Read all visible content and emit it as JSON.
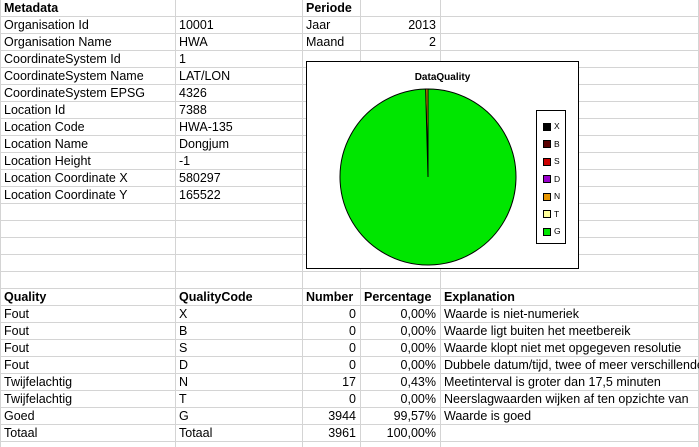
{
  "metadata": {
    "header": "Metadata",
    "rows": [
      {
        "label": "Organisation Id",
        "value": "10001"
      },
      {
        "label": "Organisation Name",
        "value": "HWA"
      },
      {
        "label": "CoordinateSystem Id",
        "value": "1"
      },
      {
        "label": "CoordinateSystem Name",
        "value": "LAT/LON"
      },
      {
        "label": "CoordinateSystem EPSG",
        "value": "4326"
      },
      {
        "label": "Location Id",
        "value": "7388"
      },
      {
        "label": "Location Code",
        "value": "HWA-135"
      },
      {
        "label": "Location Name",
        "value": "Dongjum"
      },
      {
        "label": "Location Height",
        "value": "-1"
      },
      {
        "label": "Location Coordinate X",
        "value": "580297"
      },
      {
        "label": "Location Coordinate Y",
        "value": "165522"
      }
    ]
  },
  "periode": {
    "header": "Periode",
    "rows": [
      {
        "label": "Jaar",
        "value": "2013"
      },
      {
        "label": "Maand",
        "value": "2"
      }
    ]
  },
  "quality_table": {
    "headers": [
      "Quality",
      "QualityCode",
      "Number",
      "Percentage",
      "Explanation"
    ],
    "rows": [
      [
        "Fout",
        "X",
        "0",
        "0,00%",
        "Waarde is niet-numeriek"
      ],
      [
        "Fout",
        "B",
        "0",
        "0,00%",
        "Waarde ligt buiten het meetbereik"
      ],
      [
        "Fout",
        "S",
        "0",
        "0,00%",
        "Waarde klopt niet met opgegeven resolutie"
      ],
      [
        "Fout",
        "D",
        "0",
        "0,00%",
        "Dubbele datum/tijd, twee of meer verschillende"
      ],
      [
        "Twijfelachtig",
        "N",
        "17",
        "0,43%",
        "Meetinterval is groter dan 17,5 minuten"
      ],
      [
        "Twijfelachtig",
        "T",
        "0",
        "0,00%",
        "Neerslagwaarden wijken af ten opzichte van"
      ],
      [
        "Goed",
        "G",
        "3944",
        "99,57%",
        "Waarde is goed"
      ],
      [
        "Totaal",
        "Totaal",
        "3961",
        "100,00%",
        ""
      ]
    ]
  },
  "chart_data": {
    "type": "pie",
    "title": "DataQuality",
    "categories": [
      "X",
      "B",
      "S",
      "D",
      "N",
      "T",
      "G"
    ],
    "values": [
      0,
      0,
      0,
      0,
      17,
      0,
      3944
    ],
    "colors": [
      "#000000",
      "#5a0000",
      "#cc0000",
      "#9900cc",
      "#e69500",
      "#ffff99",
      "#00e600"
    ],
    "legend": "right"
  }
}
